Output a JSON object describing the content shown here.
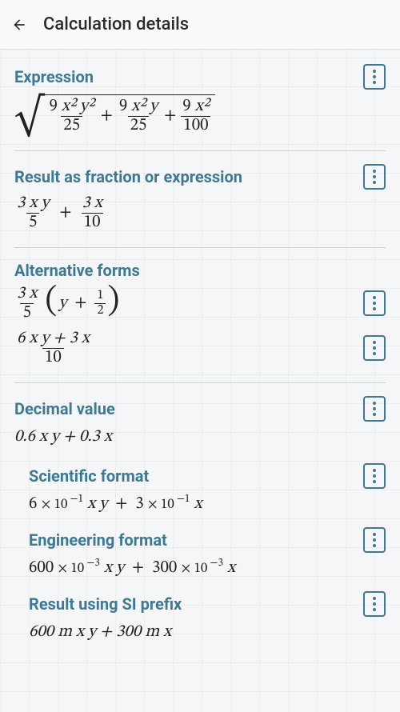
{
  "appbar": {
    "title": "Calculation details"
  },
  "sections": {
    "expression": {
      "title": "Expression",
      "terms": [
        {
          "num_coeff": "9",
          "num_vars": "x² y²",
          "den": "25"
        },
        {
          "num_coeff": "9",
          "num_vars": "x² y",
          "den": "25"
        },
        {
          "num_coeff": "9",
          "num_vars": "x²",
          "den": "100"
        }
      ]
    },
    "result_fraction": {
      "title": "Result as fraction or expression",
      "terms": [
        {
          "num": "3 x y",
          "den": "5"
        },
        {
          "num": "3 x",
          "den": "10"
        }
      ]
    },
    "alt_forms": {
      "title": "Alternative forms",
      "form1": {
        "outer_num": "3 x",
        "outer_den": "5",
        "inner_left": "y",
        "inner_num": "1",
        "inner_den": "2"
      },
      "form2": {
        "num": "6 x y + 3 x",
        "den": "10"
      }
    },
    "decimal": {
      "title": "Decimal value",
      "value": "0.6 x y + 0.3 x"
    },
    "scientific": {
      "title": "Scientific format",
      "t1_mantissa": "6",
      "t1_exp": "−1",
      "t1_vars": "x y",
      "t2_mantissa": "3",
      "t2_exp": "−1",
      "t2_vars": "x"
    },
    "engineering": {
      "title": "Engineering format",
      "t1_mantissa": "600",
      "t1_exp": "−3",
      "t1_vars": "x y",
      "t2_mantissa": "300",
      "t2_exp": "−3",
      "t2_vars": "x"
    },
    "siprefix": {
      "title": "Result using SI prefix",
      "value": "600 m x y + 300 m x"
    }
  },
  "glyphs": {
    "plus": "+",
    "times": "×",
    "ten": "10"
  }
}
